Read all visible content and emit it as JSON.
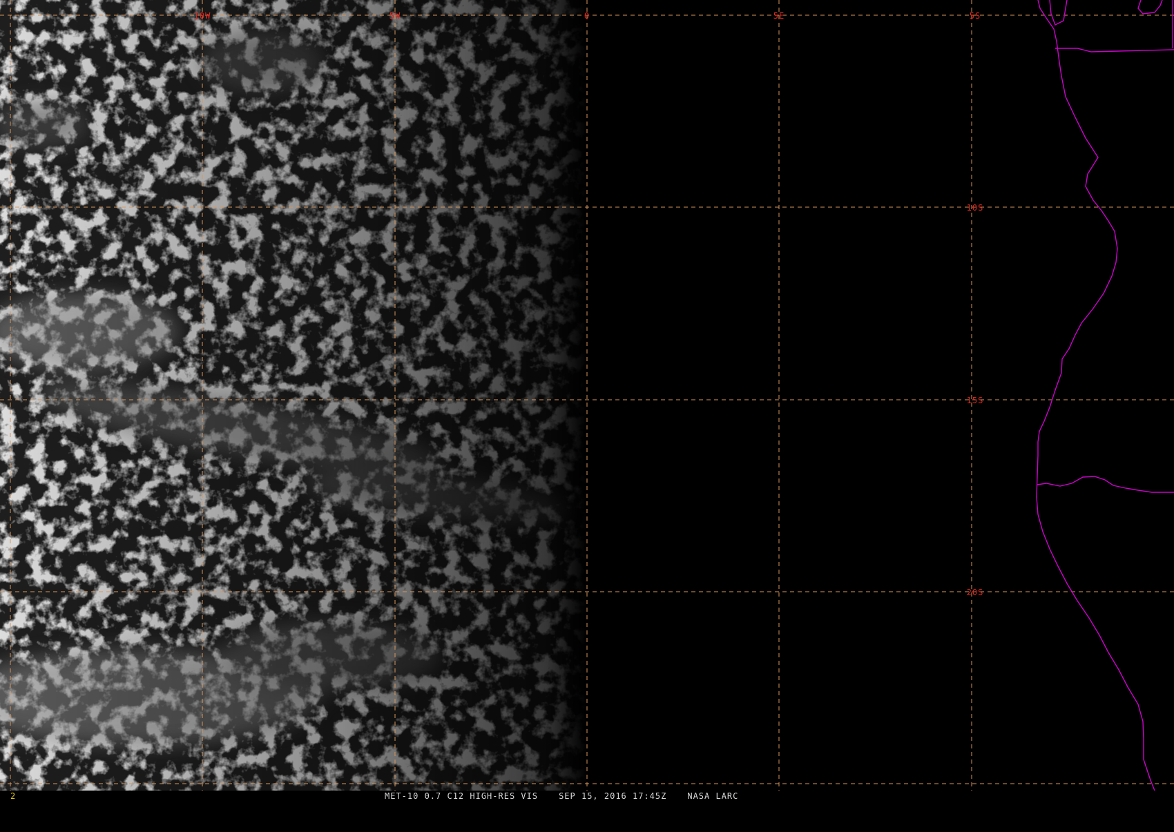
{
  "map": {
    "longitude_labels": [
      "10W",
      "5W",
      "0",
      "5E"
    ],
    "latitude_labels": [
      "5S",
      "10S",
      "15S",
      "20S"
    ],
    "colors": {
      "gridline": "#d8965a",
      "grid_label": "#e0251e",
      "coastline": "#cc00cc",
      "background": "#000000",
      "cloud": "#b8b8b8"
    },
    "imagery": "visible satellite cloud field over the ocean, dark on the night side"
  },
  "status_bar": {
    "frame_number": "2",
    "satellite": "MET-10 0.7 C12 HIGH-RES VIS",
    "datetime": "SEP 15, 2016 17:45Z",
    "source": "NASA LARC"
  }
}
